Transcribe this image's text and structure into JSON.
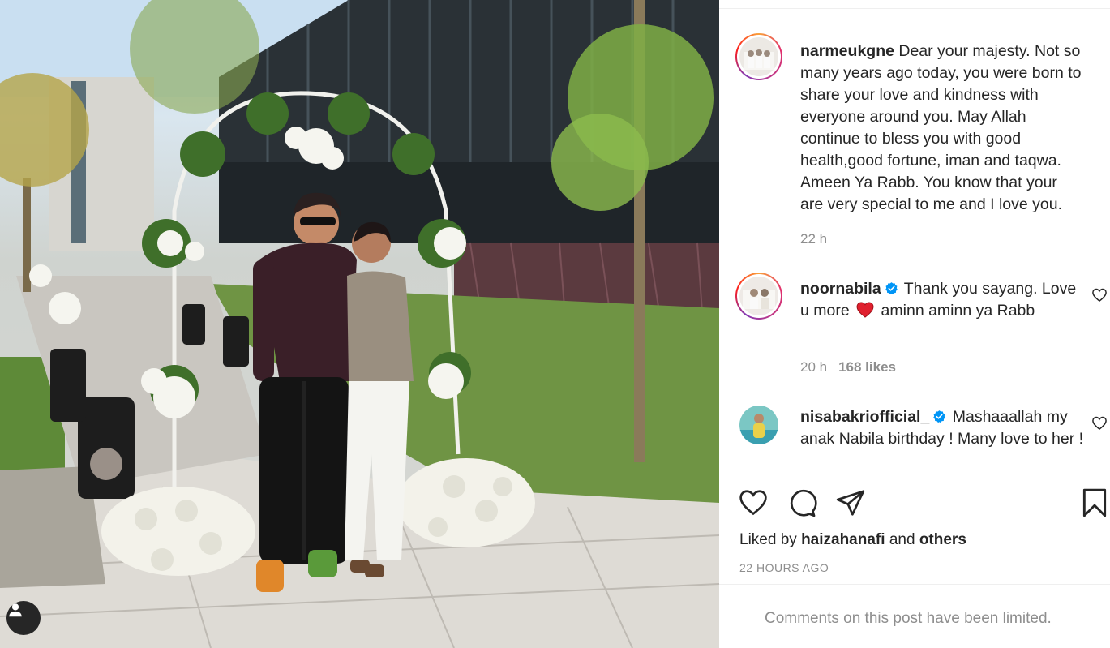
{
  "post": {
    "image_alt": "Couple standing under a white flower arch",
    "user_tag_icon": "user-tag-icon"
  },
  "caption": {
    "username": "narmeukgne",
    "text": "Dear your majesty. Not so many years ago today, you were born to share your love and kindness with everyone around you. May Allah continue to bless you with good health,good fortune, iman and taqwa. Ameen Ya Rabb. You know that your are very special to me and I love you.",
    "time": "22 h"
  },
  "comments": [
    {
      "username": "noornabila",
      "verified": true,
      "text_before": "Thank you sayang. Love u more",
      "emoji": "❤️",
      "text_after": "aminn aminn ya Rabb",
      "time": "20 h",
      "likes": "168 likes"
    },
    {
      "username": "nisabakriofficial_",
      "verified": true,
      "text": "Mashaaallah my anak Nabila birthday ! Many love to her !"
    }
  ],
  "actions": {
    "like_icon": "heart-icon",
    "comment_icon": "comment-icon",
    "share_icon": "paper-plane-icon",
    "save_icon": "bookmark-icon"
  },
  "likes_line": {
    "prefix": "Liked by",
    "user": "haizahanafi",
    "middle": "and",
    "others": "others"
  },
  "timestamp": "22 HOURS AGO",
  "comments_limited": "Comments on this post have been limited.",
  "colors": {
    "text": "#262626",
    "secondary": "#8e8e8e",
    "verified": "#0095f6",
    "heart_red": "#ed4956"
  }
}
